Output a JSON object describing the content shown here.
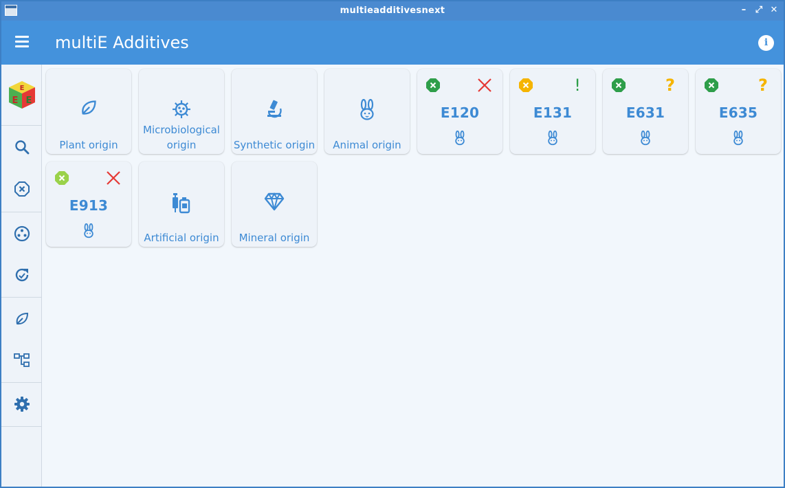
{
  "window": {
    "title": "multieadditivesnext",
    "controls": [
      "–",
      "⤢",
      "✕"
    ]
  },
  "appbar": {
    "title": "multiE Additives",
    "info_label": "i"
  },
  "sidebar": {
    "logo_letters": [
      "E",
      "E",
      "E"
    ],
    "items": [
      {
        "name": "search",
        "icon": "search-icon"
      },
      {
        "name": "filter",
        "icon": "circle-x-icon"
      },
      {
        "name": "categories",
        "icon": "dots-circle-icon"
      },
      {
        "name": "update",
        "icon": "refresh-icon"
      },
      {
        "name": "origin",
        "icon": "leaf-icon"
      },
      {
        "name": "hierarchy",
        "icon": "tree-icon"
      },
      {
        "name": "settings",
        "icon": "gear-icon"
      }
    ]
  },
  "cards": [
    {
      "type": "category",
      "label": "Plant origin",
      "icon": "leaf-icon"
    },
    {
      "type": "category",
      "label": "Microbiological origin",
      "label_lines": [
        "Microbiological",
        "origin"
      ],
      "icon": "virus-icon"
    },
    {
      "type": "category",
      "label": "Synthetic origin",
      "icon": "microscope-icon"
    },
    {
      "type": "category",
      "label": "Animal origin",
      "icon": "rabbit-icon"
    },
    {
      "type": "additive",
      "code": "E120",
      "status_color": "#2e9e4a",
      "mark": "x",
      "mark_color": "#e53935"
    },
    {
      "type": "additive",
      "code": "E131",
      "status_color": "#f5b400",
      "mark": "!",
      "mark_color": "#2e9e4a"
    },
    {
      "type": "additive",
      "code": "E631",
      "status_color": "#2e9e4a",
      "mark": "?",
      "mark_color": "#f5b400"
    },
    {
      "type": "additive",
      "code": "E635",
      "status_color": "#2e9e4a",
      "mark": "?",
      "mark_color": "#f5b400"
    },
    {
      "type": "additive",
      "code": "E913",
      "status_color": "#9ad24a",
      "mark": "x",
      "mark_color": "#e53935"
    },
    {
      "type": "category",
      "label": "Artificial origin",
      "icon": "syringe-icon"
    },
    {
      "type": "category",
      "label": "Mineral origin",
      "icon": "diamond-icon"
    }
  ],
  "colors": {
    "accent": "#4492dc",
    "text": "#3d8ad4",
    "background": "#f2f7fc"
  }
}
